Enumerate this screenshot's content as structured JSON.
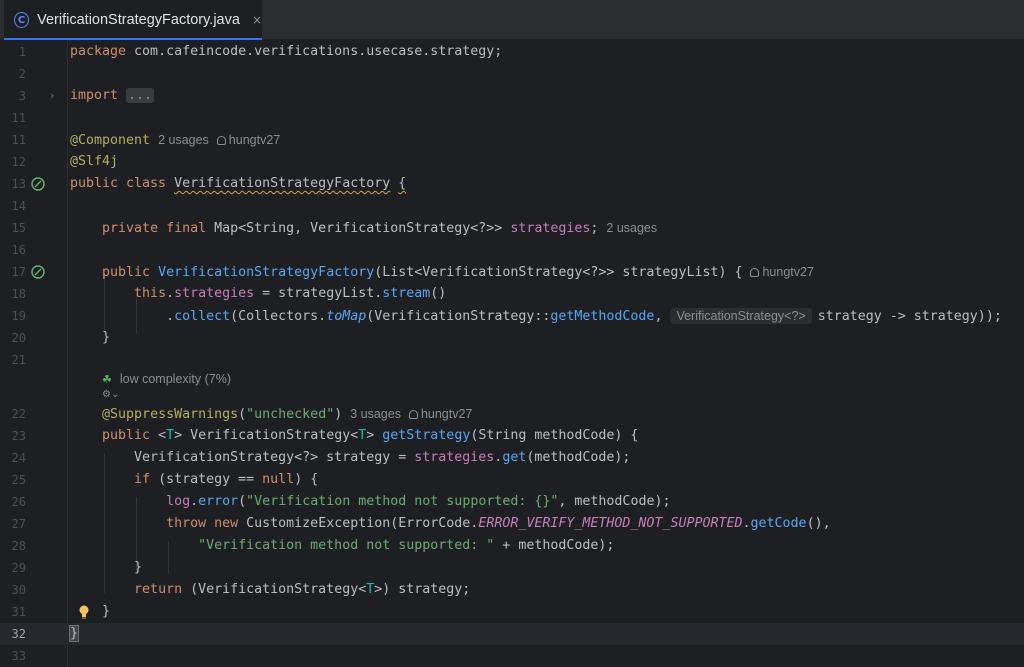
{
  "tab": {
    "title": "VerificationStrategyFactory.java",
    "close": "×",
    "icon": "C"
  },
  "inlays": {
    "usages2": "2 usages",
    "usages3": "3 usages",
    "author": "hungtv27",
    "complexity": "low complexity (7%)",
    "param_hint": "VerificationStrategy<?>"
  },
  "lines": [
    {
      "n": "1",
      "text": "package com.cafeincode.verifications.usecase.strategy;"
    },
    {
      "n": "2",
      "text": ""
    },
    {
      "n": "3",
      "text": "import ..."
    },
    {
      "n": "11",
      "text": ""
    },
    {
      "n": "11",
      "text": "@Component"
    },
    {
      "n": "12",
      "text": "@Slf4j"
    },
    {
      "n": "13",
      "text": "public class VerificationStrategyFactory {"
    },
    {
      "n": "14",
      "text": ""
    },
    {
      "n": "15",
      "text": "    private final Map<String, VerificationStrategy<?>> strategies;"
    },
    {
      "n": "16",
      "text": ""
    },
    {
      "n": "17",
      "text": "    public VerificationStrategyFactory(List<VerificationStrategy<?>> strategyList) {"
    },
    {
      "n": "18",
      "text": "        this.strategies = strategyList.stream()"
    },
    {
      "n": "19",
      "text": "            .collect(Collectors.toMap(VerificationStrategy::getMethodCode, strategy -> strategy));"
    },
    {
      "n": "20",
      "text": "    }"
    },
    {
      "n": "21",
      "text": ""
    },
    {
      "n": "22",
      "text": "    @SuppressWarnings(\"unchecked\")"
    },
    {
      "n": "23",
      "text": "    public <T> VerificationStrategy<T> getStrategy(String methodCode) {"
    },
    {
      "n": "24",
      "text": "        VerificationStrategy<?> strategy = strategies.get(methodCode);"
    },
    {
      "n": "25",
      "text": "        if (strategy == null) {"
    },
    {
      "n": "26",
      "text": "            log.error(\"Verification method not supported: {}\", methodCode);"
    },
    {
      "n": "27",
      "text": "            throw new CustomizeException(ErrorCode.ERROR_VERIFY_METHOD_NOT_SUPPORTED.getCode(),"
    },
    {
      "n": "28",
      "text": "                \"Verification method not supported: \" + methodCode);"
    },
    {
      "n": "29",
      "text": "        }"
    },
    {
      "n": "30",
      "text": "        return (VerificationStrategy<T>) strategy;"
    },
    {
      "n": "31",
      "text": "    }"
    },
    {
      "n": "32",
      "text": "}"
    },
    {
      "n": "33",
      "text": ""
    }
  ],
  "icons": {
    "class_icon": "class-icon",
    "bean_icon": "spring-bean-icon",
    "fold": "fold-arrow-icon",
    "bulb": "lightbulb-icon",
    "complexity": "complexity-icon",
    "author": "user-icon"
  },
  "colors": {
    "keyword": "#cf8e6d",
    "annotation": "#b3ae60",
    "string": "#6aab73",
    "field": "#c77dbb",
    "method": "#56a8f5",
    "type_param": "#16baac",
    "accent": "#3574f0"
  }
}
